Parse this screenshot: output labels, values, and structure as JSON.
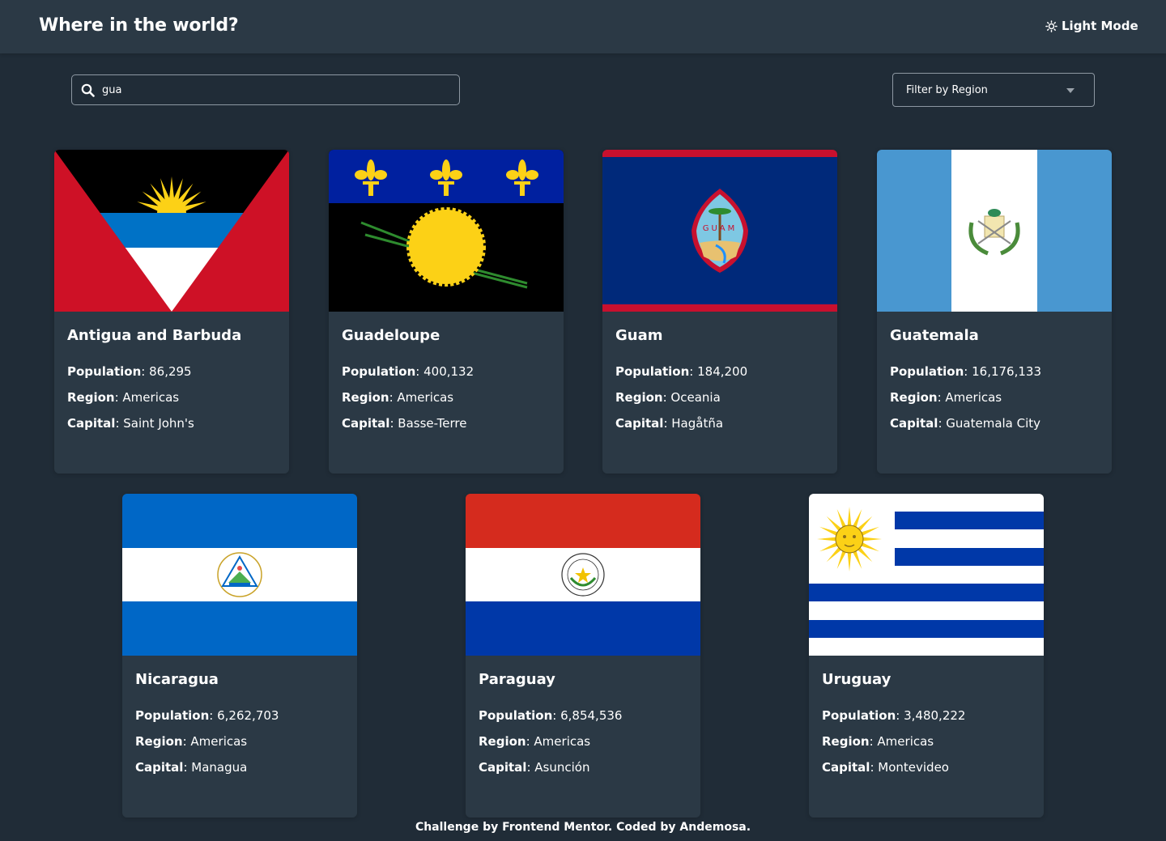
{
  "header": {
    "title": "Where in the world?",
    "mode_label": "Light Mode",
    "mode_icon": "sun-icon"
  },
  "search": {
    "value": "gua",
    "icon": "search-icon"
  },
  "filter": {
    "label": "Filter by Region",
    "icon": "caret-down-icon"
  },
  "labels": {
    "population": "Population",
    "region": "Region",
    "capital": "Capital"
  },
  "countries": [
    {
      "name": "Antigua and Barbuda",
      "population": "86,295",
      "region": "Americas",
      "capital": "Saint John's"
    },
    {
      "name": "Guadeloupe",
      "population": "400,132",
      "region": "Americas",
      "capital": "Basse-Terre"
    },
    {
      "name": "Guam",
      "population": "184,200",
      "region": "Oceania",
      "capital": "Hagåtña"
    },
    {
      "name": "Guatemala",
      "population": "16,176,133",
      "region": "Americas",
      "capital": "Guatemala City"
    },
    {
      "name": "Nicaragua",
      "population": "6,262,703",
      "region": "Americas",
      "capital": "Managua"
    },
    {
      "name": "Paraguay",
      "population": "6,854,536",
      "region": "Americas",
      "capital": "Asunción"
    },
    {
      "name": "Uruguay",
      "population": "3,480,222",
      "region": "Americas",
      "capital": "Montevideo"
    }
  ],
  "footer": {
    "text": "Challenge by Frontend Mentor. Coded by Andemosa."
  },
  "colors": {
    "background": "#202c37",
    "surface": "#2b3945",
    "text": "#ffffff"
  }
}
